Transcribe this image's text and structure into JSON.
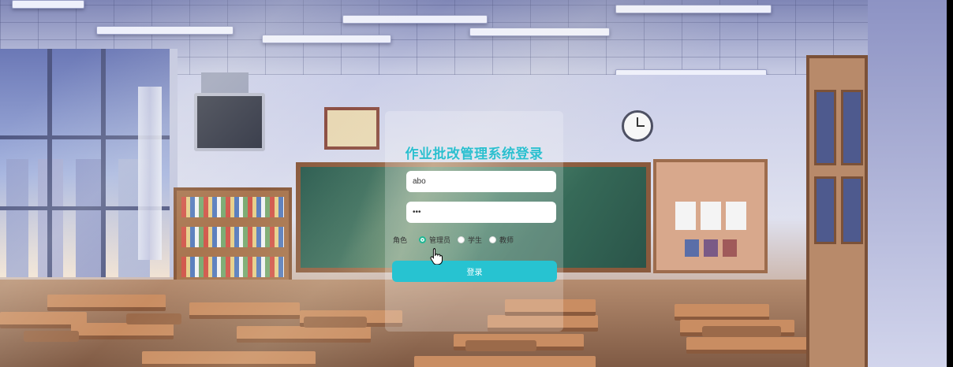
{
  "page": {
    "title": "作业批改管理系统登录"
  },
  "form": {
    "username_value": "abo",
    "password_value": "•••",
    "role_label": "角色",
    "roles": [
      {
        "label": "管理员",
        "checked": true
      },
      {
        "label": "学生",
        "checked": false
      },
      {
        "label": "教师",
        "checked": false
      }
    ],
    "submit_label": "登录"
  },
  "colors": {
    "accent": "#27c3d1",
    "title": "#2bbfcf",
    "radio_checked": "#1fb894"
  },
  "icons": {
    "cursor": "hand-pointer-icon"
  }
}
